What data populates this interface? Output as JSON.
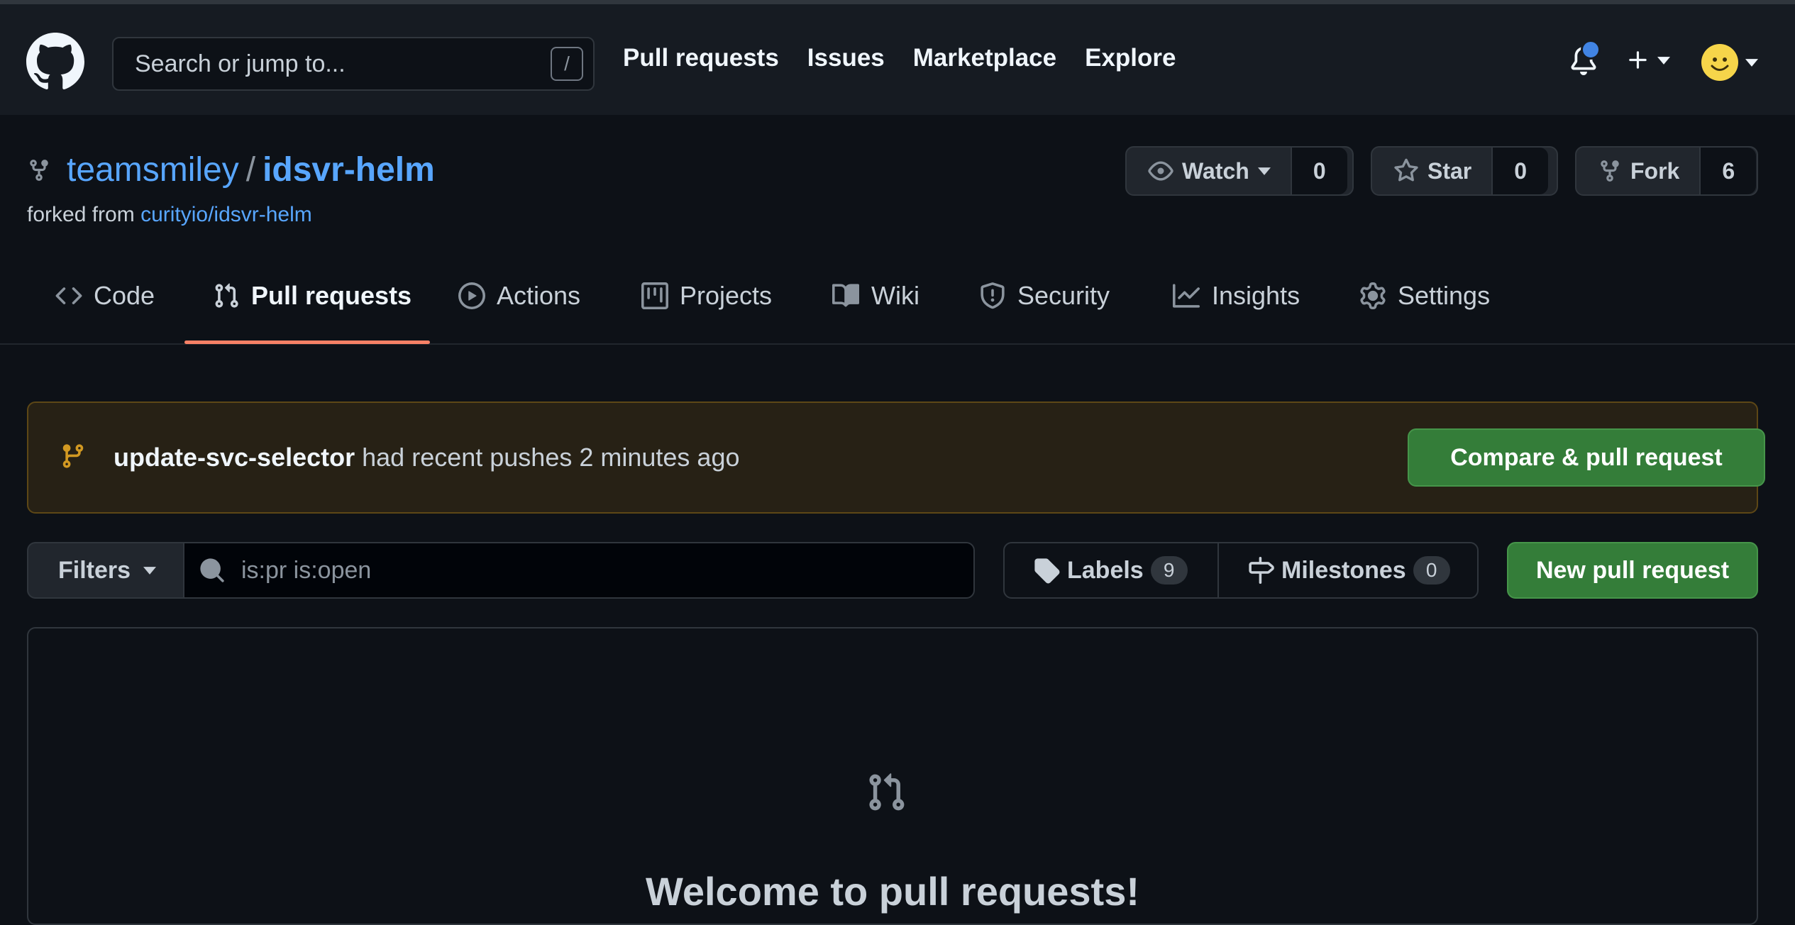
{
  "header": {
    "search_placeholder": "Search or jump to...",
    "search_shortcut": "/",
    "nav": [
      "Pull requests",
      "Issues",
      "Marketplace",
      "Explore"
    ]
  },
  "repo": {
    "owner": "teamsmiley",
    "separator": "/",
    "name": "idsvr-helm",
    "forked_prefix": "forked from",
    "forked_source": "curityio/idsvr-helm",
    "watch": {
      "label": "Watch",
      "count": "0"
    },
    "star": {
      "label": "Star",
      "count": "0"
    },
    "fork": {
      "label": "Fork",
      "count": "6"
    }
  },
  "tabs": [
    {
      "label": "Code",
      "icon": "code-icon"
    },
    {
      "label": "Pull requests",
      "icon": "git-pull-request-icon",
      "active": true
    },
    {
      "label": "Actions",
      "icon": "play-icon"
    },
    {
      "label": "Projects",
      "icon": "project-icon"
    },
    {
      "label": "Wiki",
      "icon": "book-icon"
    },
    {
      "label": "Security",
      "icon": "shield-icon"
    },
    {
      "label": "Insights",
      "icon": "graph-icon"
    },
    {
      "label": "Settings",
      "icon": "gear-icon"
    }
  ],
  "banner": {
    "branch": "update-svc-selector",
    "message": "had recent pushes 2 minutes ago",
    "button": "Compare & pull request"
  },
  "filter_bar": {
    "filters_label": "Filters",
    "query": "is:pr is:open",
    "labels_label": "Labels",
    "labels_count": "9",
    "milestones_label": "Milestones",
    "milestones_count": "0",
    "new_pr_label": "New pull request"
  },
  "blankslate": {
    "title": "Welcome to pull requests!"
  },
  "colors": {
    "accent_link": "#58a6ff",
    "active_tab_underline": "#f78166",
    "primary_button": "#347d39",
    "notification_dot": "#4184e4"
  }
}
